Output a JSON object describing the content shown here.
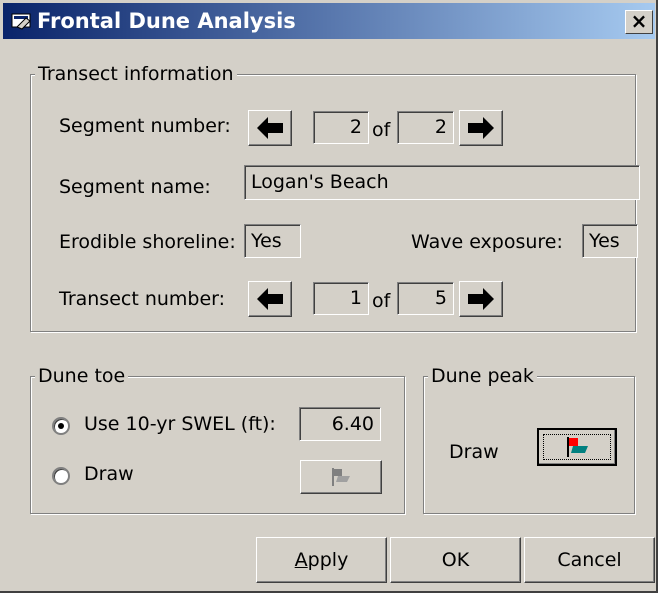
{
  "window": {
    "title": "Frontal Dune Analysis",
    "close_label": "×"
  },
  "transect": {
    "group_label": "Transect information",
    "segment_number_label": "Segment number:",
    "segment_current": "2",
    "segment_of": "of",
    "segment_total": "2",
    "segment_name_label": "Segment name:",
    "segment_name": "Logan's Beach",
    "erodible_label": "Erodible shoreline:",
    "erodible_value": "Yes",
    "wave_label": "Wave exposure:",
    "wave_value": "Yes",
    "transect_number_label": "Transect number:",
    "transect_current": "1",
    "transect_of": "of",
    "transect_total": "5"
  },
  "dune_toe": {
    "group_label": "Dune toe",
    "option_swel_label": "Use 10-yr SWEL (ft):",
    "swel_value": "6.40",
    "option_draw_label": "Draw",
    "selected": "swel"
  },
  "dune_peak": {
    "group_label": "Dune peak",
    "draw_label": "Draw"
  },
  "buttons": {
    "apply_prefix": "A",
    "apply_rest": "pply",
    "ok": "OK",
    "cancel": "Cancel"
  },
  "colors": {
    "title_start": "#0a246a",
    "title_end": "#a6caf0",
    "flag_red": "#ff0000",
    "flag_teal": "#008080"
  }
}
